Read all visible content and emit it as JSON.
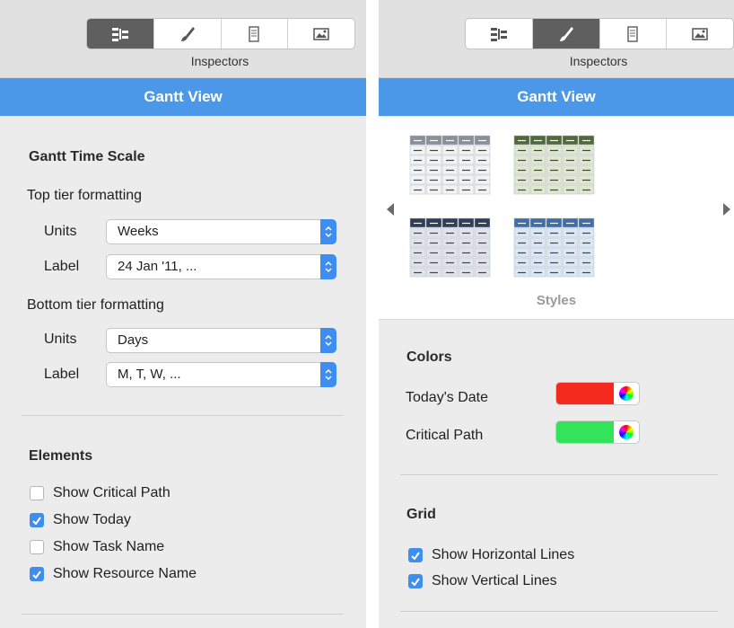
{
  "left_panel": {
    "inspectors_label": "Inspectors",
    "title": "Gantt View",
    "time_scale_heading": "Gantt Time Scale",
    "top_tier": {
      "heading": "Top tier formatting",
      "units_label": "Units",
      "units_value": "Weeks",
      "label_label": "Label",
      "label_value": "24 Jan '11, ..."
    },
    "bottom_tier": {
      "heading": "Bottom tier formatting",
      "units_label": "Units",
      "units_value": "Days",
      "label_label": "Label",
      "label_value": "M, T, W, ..."
    },
    "elements_heading": "Elements",
    "elements": [
      {
        "label": "Show Critical Path",
        "checked": false
      },
      {
        "label": "Show Today",
        "checked": true
      },
      {
        "label": "Show Task Name",
        "checked": false
      },
      {
        "label": "Show Resource Name",
        "checked": true
      }
    ]
  },
  "right_panel": {
    "inspectors_label": "Inspectors",
    "title": "Gantt View",
    "styles_caption": "Styles",
    "colors_heading": "Colors",
    "colors": [
      {
        "label": "Today's Date",
        "color": "#f42a1e"
      },
      {
        "label": "Critical Path",
        "color": "#33e35a"
      }
    ],
    "grid_heading": "Grid",
    "grid": [
      {
        "label": "Show Horizontal Lines",
        "checked": true
      },
      {
        "label": "Show Vertical Lines",
        "checked": true
      }
    ]
  },
  "style_thumbs": [
    {
      "name": "gray",
      "header": "#8a9099",
      "tint": "#f2f3f4"
    },
    {
      "name": "green",
      "header": "#4f6b3a",
      "tint": "#dde8cf"
    },
    {
      "name": "navy",
      "header": "#2f3f59",
      "tint": "#dfe4ec"
    },
    {
      "name": "blue",
      "header": "#3f6ea8",
      "tint": "#dae7f6"
    }
  ],
  "accent_color": "#4c98e8"
}
